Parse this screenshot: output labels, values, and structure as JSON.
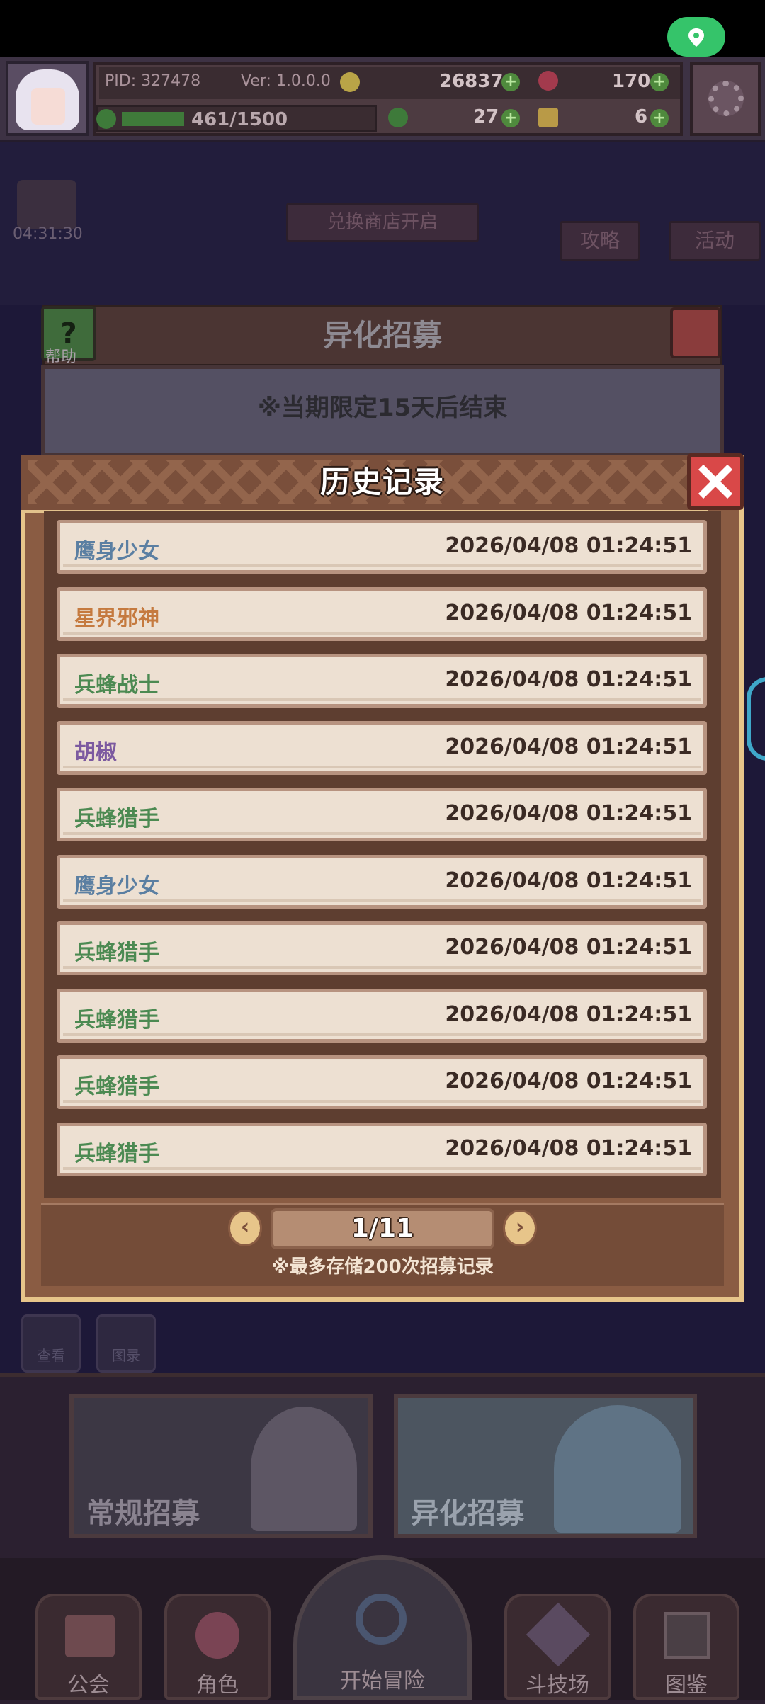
{
  "hud": {
    "pid": "PID: 327478",
    "ver": "Ver: 1.0.0.0",
    "gold": "26837",
    "gems": "170",
    "exp": "461/1500",
    "clover": "27",
    "keys": "6",
    "plus": "+"
  },
  "background": {
    "timer": "04:31:30",
    "shop_banner": "兑换商店开启",
    "guide": "攻略",
    "event": "活动",
    "help": "帮助",
    "recruit_title": "异化招募",
    "limited_notice": "※当期限定15天后结束",
    "small_btn1": "查看",
    "small_btn2": "图录"
  },
  "dialog": {
    "title": "历史记录",
    "records": [
      {
        "name": "鹰身少女",
        "time": "2026/04/08 01:24:51",
        "color": "#5b7fa2"
      },
      {
        "name": "星界邪神",
        "time": "2026/04/08 01:24:51",
        "color": "#c57a3f"
      },
      {
        "name": "兵蜂战士",
        "time": "2026/04/08 01:24:51",
        "color": "#4c8a52"
      },
      {
        "name": "胡椒",
        "time": "2026/04/08 01:24:51",
        "color": "#7c5aa0"
      },
      {
        "name": "兵蜂猎手",
        "time": "2026/04/08 01:24:51",
        "color": "#4c8a52"
      },
      {
        "name": "鹰身少女",
        "time": "2026/04/08 01:24:51",
        "color": "#5b7fa2"
      },
      {
        "name": "兵蜂猎手",
        "time": "2026/04/08 01:24:51",
        "color": "#4c8a52"
      },
      {
        "name": "兵蜂猎手",
        "time": "2026/04/08 01:24:51",
        "color": "#4c8a52"
      },
      {
        "name": "兵蜂猎手",
        "time": "2026/04/08 01:24:51",
        "color": "#4c8a52"
      },
      {
        "name": "兵蜂猎手",
        "time": "2026/04/08 01:24:51",
        "color": "#4c8a52"
      }
    ],
    "page": "1/11",
    "prev": "‹",
    "next": "›",
    "note": "※最多存储200次招募记录"
  },
  "cards": {
    "normal": "常规招募",
    "special": "异化招募"
  },
  "nav": {
    "guild": "公会",
    "role": "角色",
    "adventure": "开始冒险",
    "arena": "斗技场",
    "codex": "图鉴"
  }
}
